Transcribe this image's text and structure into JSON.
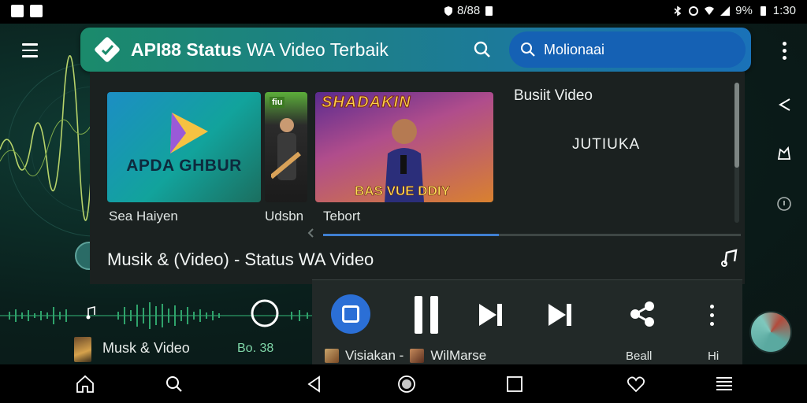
{
  "status_bar": {
    "notification_text": "8/88",
    "battery": "9%",
    "time": "1:30",
    "icons": [
      "notification-icon",
      "media-icon",
      "shield-icon",
      "sim-icon",
      "bluetooth-icon",
      "alarm-icon",
      "wifi-icon",
      "signal-icon",
      "battery-icon"
    ]
  },
  "app_bar": {
    "title_bold": "API88 Status",
    "title_rest": " WA Video Terbaik",
    "search_value": "Molionaai",
    "icons": [
      "menu-icon",
      "logo-icon",
      "search-icon",
      "more-icon"
    ]
  },
  "content": {
    "thumbnails": [
      {
        "caption_in_image": "APDA GHBUR",
        "label": "Sea Haiyen"
      },
      {
        "caption_in_image": "fiu",
        "label": "Udsbn"
      },
      {
        "caption_in_image": "SHADAKIN",
        "caption_bottom": "BAS VUE DDIY",
        "label": "Tebort"
      }
    ],
    "side_title": "Busiit Video",
    "side_label": "JUTIUKA",
    "scroll_fraction": 0.6,
    "progress_fraction": 0.42,
    "now_playing_title": "Musik & (Video) - Status WA Video"
  },
  "left_panel": {
    "mini_title": "Musk & Video",
    "mini_count": "Bo. 38"
  },
  "player": {
    "controls": [
      "app-icon",
      "pause-icon",
      "next-icon",
      "skip-icon",
      "share-icon",
      "more-icon"
    ],
    "queue_item_1": "Visiakan -",
    "queue_item_2": "WilMarse",
    "label_1": "Beall",
    "label_2": "Hi"
  },
  "nav_bar": {
    "icons": [
      "home-icon",
      "search-icon",
      "back-icon",
      "record-icon",
      "recent-icon",
      "heart-icon",
      "list-icon"
    ]
  },
  "colors": {
    "app_bar_start": "#1b8a6b",
    "app_bar_end": "#1a72b8",
    "search_field": "#1561b4",
    "accent_blue": "#2b6fd6",
    "panel_bg": "#1b2120",
    "count_green": "#7fd6a8"
  }
}
